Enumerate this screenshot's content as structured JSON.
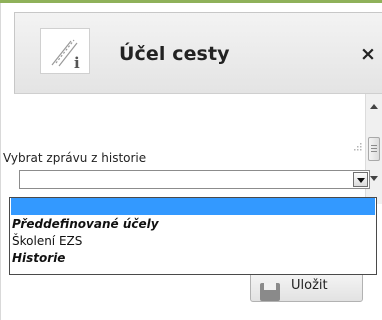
{
  "dialog": {
    "title": "Účel cesty",
    "close_label": "×",
    "icon": "info-document-icon"
  },
  "message_field": {
    "value": ""
  },
  "history": {
    "label": "Vybrat zprávu z historie",
    "selected_value": ""
  },
  "dropdown": {
    "items": [
      {
        "label": "",
        "selected": true
      },
      {
        "label": "Předdefinované účely",
        "group": true
      },
      {
        "label": "Školení EZS"
      },
      {
        "label": "Historie",
        "group": true
      }
    ]
  },
  "save_button": {
    "label": "Uložit",
    "icon": "save-icon"
  },
  "colors": {
    "accent": "#8fb15a",
    "selection": "#3399ff"
  }
}
